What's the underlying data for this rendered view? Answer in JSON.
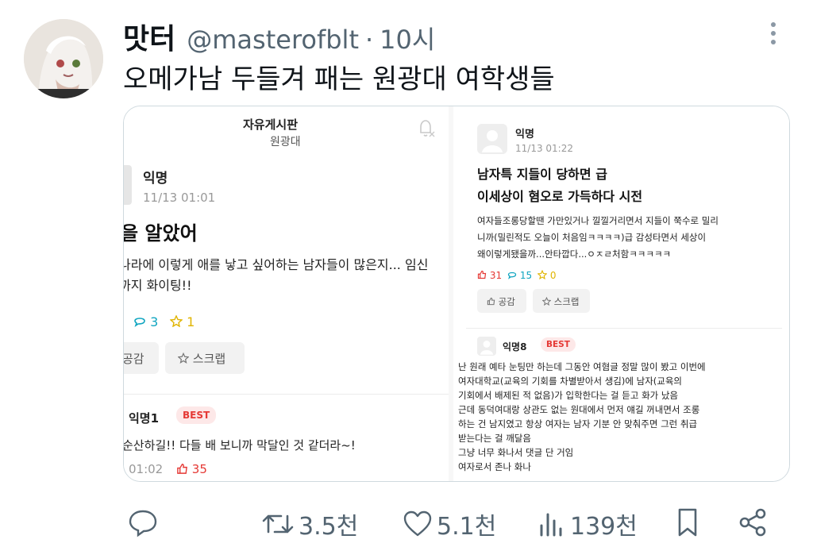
{
  "tweet": {
    "author_name": "맛터",
    "handle": "@masterofblt",
    "separator": "·",
    "time": "10시",
    "text": "오메가남 두들겨 패는 원광대 여학생들"
  },
  "left_screenshot": {
    "board_title": "자유게시판",
    "board_subtitle": "원광대",
    "post": {
      "user": "익명",
      "date": "11/13 01:01",
      "title": "을 알았어",
      "body_line1": "나라에 이렇게 애를 낳고 싶어하는 남자들이 많은지... 임신",
      "body_line2": "까지 화이팅!!",
      "comments": "3",
      "scraps": "1",
      "like_button": "공감",
      "scrap_button": "스크랩"
    },
    "comment": {
      "user": "익명1",
      "badge": "BEST",
      "body": "순산하길!! 다들 배 보니까 막달인 것 같더라~!",
      "date": "01:02",
      "likes": "35"
    }
  },
  "right_screenshot": {
    "post": {
      "user": "익명",
      "date": "11/13 01:22",
      "title_line1": "남자특 지들이 당하면 급",
      "title_line2": "이세상이 혐오로 가득하다 시전",
      "body": [
        "여자들조롱당할땐 가만있거나 낄낄거리면서 지들이 쭉수로 밀리",
        "니까(밀린적도 오늘이 처음임ㅋㅋㅋㅋ)급 감성타면서 세상이",
        "왜이렇게됐을까...안타깝다...ㅇㅈㄹ처함ㅋㅋㅋㅋㅋ"
      ],
      "likes": "31",
      "comments": "15",
      "scraps": "0",
      "like_button": "공감",
      "scrap_button": "스크랩"
    },
    "comment": {
      "user": "익명8",
      "badge": "BEST",
      "body": [
        "난 원래 예타 눈팅만 하는데 그동안 여혐글 정말 많이 봤고 이번에",
        "여자대학교(교육의 기회를 차별받아서 생김)에 남자(교육의",
        "기회에서 배제된 적 없음)가 입학한다는 걸 듣고 화가 났음",
        "근데 동덕여대랑 상관도 없는 원대에서 먼저 얘길 꺼내면서 조롱",
        "하는 건 남지였고 항상 여자는 남자 기분 안 맞춰주면 그런 취급",
        "받는다는 걸 깨달음",
        "그냥 너무 화나서 댓글 단 거임",
        "여자로서 존나 화나"
      ]
    }
  },
  "actions": {
    "retweets": "3.5천",
    "likes": "5.1천",
    "views": "139천"
  },
  "colors": {
    "handle_gray": "#536471",
    "best_red": "#e53935",
    "comment_teal": "#10a5c0",
    "scrap_yellow": "#e0b400"
  },
  "icons": [
    "more-icon",
    "bell-off-icon",
    "comment-icon",
    "star-icon",
    "heart-icon",
    "reply-icon",
    "retweet-icon",
    "views-icon",
    "bookmark-icon",
    "share-icon"
  ]
}
